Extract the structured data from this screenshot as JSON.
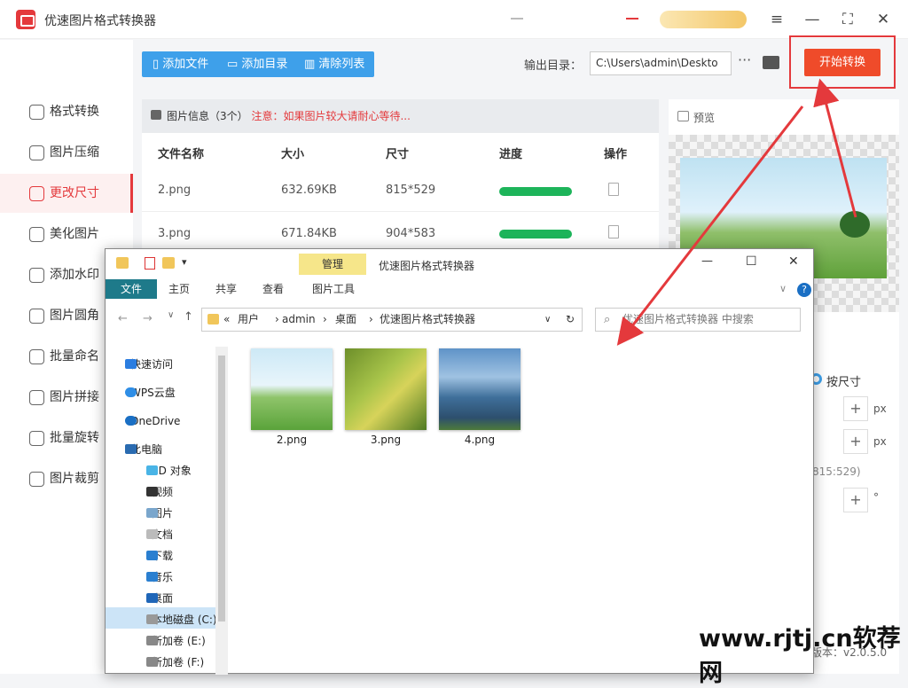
{
  "app": {
    "title": "优速图片格式转换器",
    "version_label": "版本：v2.0.5.0"
  },
  "window_controls": {
    "menu": "≡",
    "minimize": "—",
    "maximize": "⛶",
    "close": "✕"
  },
  "sidebar": {
    "items": [
      {
        "label": "格式转换",
        "icon": "convert-icon"
      },
      {
        "label": "图片压缩",
        "icon": "compress-icon"
      },
      {
        "label": "更改尺寸",
        "icon": "resize-icon",
        "active": true
      },
      {
        "label": "美化图片",
        "icon": "beautify-icon"
      },
      {
        "label": "添加水印",
        "icon": "watermark-icon"
      },
      {
        "label": "图片圆角",
        "icon": "round-corner-icon"
      },
      {
        "label": "批量命名",
        "icon": "rename-icon"
      },
      {
        "label": "图片拼接",
        "icon": "stitch-icon"
      },
      {
        "label": "批量旋转",
        "icon": "rotate-icon"
      },
      {
        "label": "图片裁剪",
        "icon": "crop-icon"
      }
    ]
  },
  "toolbar": {
    "add_file": "添加文件",
    "add_folder": "添加目录",
    "clear_list": "清除列表"
  },
  "output": {
    "label": "输出目录：",
    "path": "C:\\Users\\admin\\Deskto",
    "more": "···"
  },
  "start_button": "开始转换",
  "info": {
    "title": "图片信息（3个）",
    "warning": "注意：如果图片较大请耐心等待..."
  },
  "table": {
    "headers": [
      "文件名称",
      "大小",
      "尺寸",
      "进度",
      "操作"
    ],
    "rows": [
      {
        "name": "2.png",
        "size": "632.69KB",
        "dims": "815*529",
        "progress": 1.0
      },
      {
        "name": "3.png",
        "size": "671.84KB",
        "dims": "904*583",
        "progress": 1.0
      }
    ]
  },
  "preview": {
    "label": "预览"
  },
  "settings": {
    "by_size": "按尺寸",
    "px": "px",
    "original": "815:529)",
    "degree": "°",
    "plus": "+"
  },
  "explorer": {
    "title": "优速图片格式转换器",
    "manage_tab": "管理",
    "tabs": [
      "文件",
      "主页",
      "共享",
      "查看",
      "图片工具"
    ],
    "address": [
      "«",
      "用户",
      "admin",
      "桌面",
      "优速图片格式转换器"
    ],
    "search_placeholder": "优速图片格式转换器 中搜索",
    "nav": [
      "快速访问",
      "WPS云盘",
      "OneDrive",
      "此电脑",
      "3D 对象",
      "视频",
      "图片",
      "文档",
      "下载",
      "音乐",
      "桌面",
      "本地磁盘 (C:)",
      "新加卷 (E:)",
      "新加卷 (F:)"
    ],
    "files": [
      "2.png",
      "3.png",
      "4.png"
    ],
    "controls": {
      "minimize": "—",
      "maximize": "☐",
      "close": "✕"
    }
  },
  "watermark": "www.rjtj.cn软荐网",
  "colors": {
    "accent": "#e4393c",
    "blue": "#3ea0ea",
    "progress": "#1db45a",
    "start": "#ef4b2a"
  }
}
